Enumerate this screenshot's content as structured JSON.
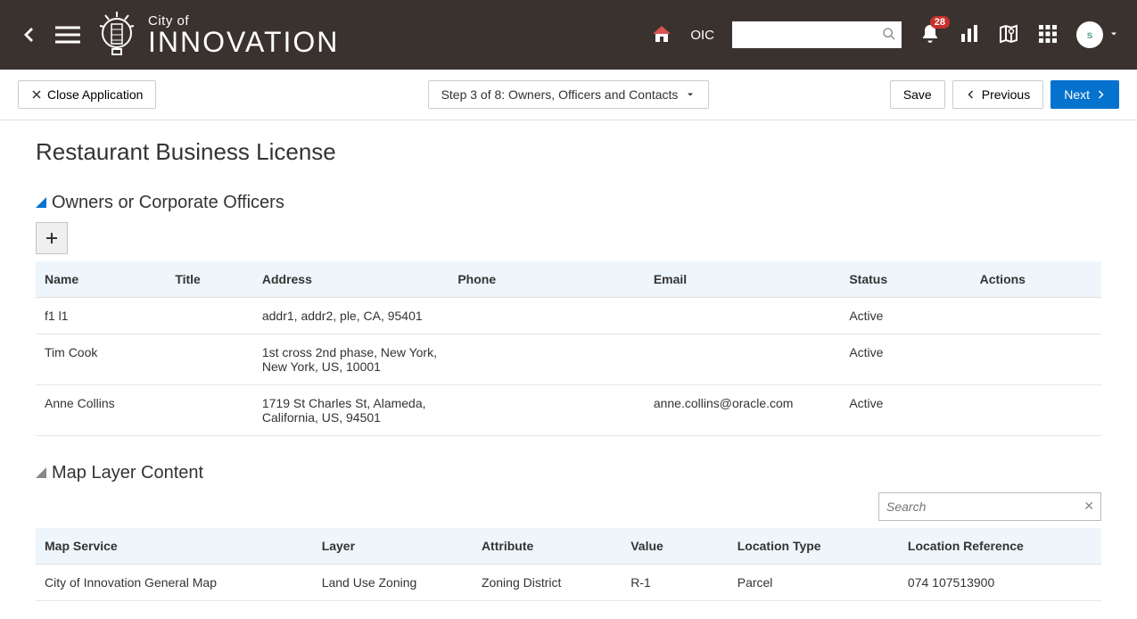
{
  "header": {
    "brand_top": "City of",
    "brand_main": "INNOVATION",
    "app_abbrev": "OIC",
    "notification_count": "28",
    "avatar_initial": "s"
  },
  "toolbar": {
    "close_label": "Close Application",
    "step_label": "Step 3 of 8: Owners, Officers and Contacts",
    "save_label": "Save",
    "previous_label": "Previous",
    "next_label": "Next"
  },
  "page": {
    "title": "Restaurant Business License"
  },
  "owners_section": {
    "title": "Owners or Corporate Officers",
    "columns": {
      "name": "Name",
      "title": "Title",
      "address": "Address",
      "phone": "Phone",
      "email": "Email",
      "status": "Status",
      "actions": "Actions"
    },
    "rows": [
      {
        "name": "f1 l1",
        "title": "",
        "address": "addr1, addr2, ple, CA, 95401",
        "phone": "",
        "email": "",
        "status": "Active"
      },
      {
        "name": "Tim Cook",
        "title": "",
        "address": "1st cross 2nd phase, New York, New York, US, 10001",
        "phone": "",
        "email": "",
        "status": "Active"
      },
      {
        "name": "Anne Collins",
        "title": "",
        "address": "1719 St Charles St, Alameda, California, US, 94501",
        "phone": "",
        "email": "anne.collins@oracle.com",
        "status": "Active"
      }
    ]
  },
  "map_section": {
    "title": "Map Layer Content",
    "search_placeholder": "Search",
    "columns": {
      "service": "Map Service",
      "layer": "Layer",
      "attribute": "Attribute",
      "value": "Value",
      "loc_type": "Location Type",
      "loc_ref": "Location Reference"
    },
    "rows": [
      {
        "service": "City of Innovation General Map",
        "layer": "Land Use Zoning",
        "attribute": "Zoning District",
        "value": "R-1",
        "loc_type": "Parcel",
        "loc_ref": "074 107513900"
      }
    ]
  }
}
